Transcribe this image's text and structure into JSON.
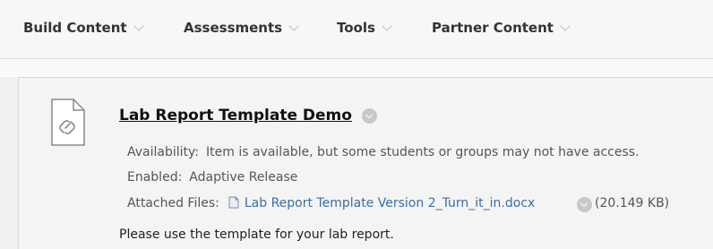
{
  "toolbar": {
    "items": [
      {
        "label": "Build Content"
      },
      {
        "label": "Assessments"
      },
      {
        "label": "Tools"
      },
      {
        "label": "Partner Content"
      }
    ]
  },
  "content_item": {
    "icon": "document-link-icon",
    "title": "Lab Report Template Demo",
    "availability_label": "Availability:",
    "availability_value": "Item is available, but some students or groups may not have access.",
    "enabled_label": "Enabled:",
    "enabled_value": "Adaptive Release",
    "attached_label": "Attached Files:",
    "attached_file_name": "Lab Report Template Version 2_Turn_it_in.docx",
    "attached_file_size": "(20.149 KB)",
    "description": "Please use the template for your lab report."
  }
}
